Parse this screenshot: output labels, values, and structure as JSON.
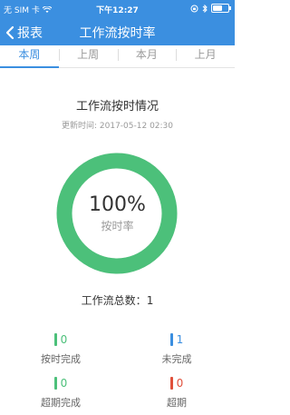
{
  "status_bar": {
    "carrier": "无 SIM 卡",
    "time": "下午12:27"
  },
  "nav": {
    "back_label": "报表",
    "title": "工作流按时率"
  },
  "tabs": [
    {
      "label": "本周",
      "active": true
    },
    {
      "label": "上周",
      "active": false
    },
    {
      "label": "本月",
      "active": false
    },
    {
      "label": "上月",
      "active": false
    }
  ],
  "summary": {
    "title": "工作流按时情况",
    "updated_label": "更新时间:",
    "updated_time": "2017-05-12 02:30"
  },
  "gauge": {
    "percent_text": "100%",
    "label": "按时率",
    "fraction": 1.0,
    "color": "#4cc07a"
  },
  "total": {
    "label": "工作流总数：",
    "value": "1"
  },
  "stats": [
    {
      "value": "0",
      "label": "按时完成",
      "color": "#4cc07a"
    },
    {
      "value": "1",
      "label": "未完成",
      "color": "#3b8fe0"
    },
    {
      "value": "0",
      "label": "超期完成",
      "color": "#4cc07a"
    },
    {
      "value": "0",
      "label": "超期",
      "color": "#e0503b"
    }
  ],
  "colors": {
    "header": "#3b8fe0",
    "accent": "#3b8fe0"
  }
}
